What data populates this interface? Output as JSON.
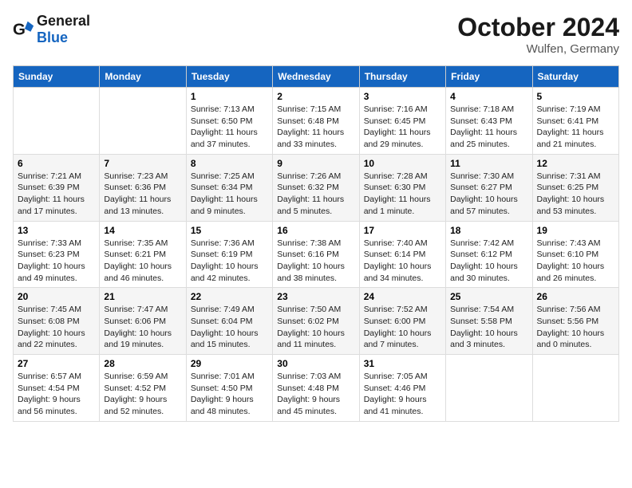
{
  "logo": {
    "general": "General",
    "blue": "Blue"
  },
  "title": "October 2024",
  "location": "Wulfen, Germany",
  "weekdays": [
    "Sunday",
    "Monday",
    "Tuesday",
    "Wednesday",
    "Thursday",
    "Friday",
    "Saturday"
  ],
  "weeks": [
    [
      {
        "day": "",
        "info": ""
      },
      {
        "day": "",
        "info": ""
      },
      {
        "day": "1",
        "info": "Sunrise: 7:13 AM\nSunset: 6:50 PM\nDaylight: 11 hours and 37 minutes."
      },
      {
        "day": "2",
        "info": "Sunrise: 7:15 AM\nSunset: 6:48 PM\nDaylight: 11 hours and 33 minutes."
      },
      {
        "day": "3",
        "info": "Sunrise: 7:16 AM\nSunset: 6:45 PM\nDaylight: 11 hours and 29 minutes."
      },
      {
        "day": "4",
        "info": "Sunrise: 7:18 AM\nSunset: 6:43 PM\nDaylight: 11 hours and 25 minutes."
      },
      {
        "day": "5",
        "info": "Sunrise: 7:19 AM\nSunset: 6:41 PM\nDaylight: 11 hours and 21 minutes."
      }
    ],
    [
      {
        "day": "6",
        "info": "Sunrise: 7:21 AM\nSunset: 6:39 PM\nDaylight: 11 hours and 17 minutes."
      },
      {
        "day": "7",
        "info": "Sunrise: 7:23 AM\nSunset: 6:36 PM\nDaylight: 11 hours and 13 minutes."
      },
      {
        "day": "8",
        "info": "Sunrise: 7:25 AM\nSunset: 6:34 PM\nDaylight: 11 hours and 9 minutes."
      },
      {
        "day": "9",
        "info": "Sunrise: 7:26 AM\nSunset: 6:32 PM\nDaylight: 11 hours and 5 minutes."
      },
      {
        "day": "10",
        "info": "Sunrise: 7:28 AM\nSunset: 6:30 PM\nDaylight: 11 hours and 1 minute."
      },
      {
        "day": "11",
        "info": "Sunrise: 7:30 AM\nSunset: 6:27 PM\nDaylight: 10 hours and 57 minutes."
      },
      {
        "day": "12",
        "info": "Sunrise: 7:31 AM\nSunset: 6:25 PM\nDaylight: 10 hours and 53 minutes."
      }
    ],
    [
      {
        "day": "13",
        "info": "Sunrise: 7:33 AM\nSunset: 6:23 PM\nDaylight: 10 hours and 49 minutes."
      },
      {
        "day": "14",
        "info": "Sunrise: 7:35 AM\nSunset: 6:21 PM\nDaylight: 10 hours and 46 minutes."
      },
      {
        "day": "15",
        "info": "Sunrise: 7:36 AM\nSunset: 6:19 PM\nDaylight: 10 hours and 42 minutes."
      },
      {
        "day": "16",
        "info": "Sunrise: 7:38 AM\nSunset: 6:16 PM\nDaylight: 10 hours and 38 minutes."
      },
      {
        "day": "17",
        "info": "Sunrise: 7:40 AM\nSunset: 6:14 PM\nDaylight: 10 hours and 34 minutes."
      },
      {
        "day": "18",
        "info": "Sunrise: 7:42 AM\nSunset: 6:12 PM\nDaylight: 10 hours and 30 minutes."
      },
      {
        "day": "19",
        "info": "Sunrise: 7:43 AM\nSunset: 6:10 PM\nDaylight: 10 hours and 26 minutes."
      }
    ],
    [
      {
        "day": "20",
        "info": "Sunrise: 7:45 AM\nSunset: 6:08 PM\nDaylight: 10 hours and 22 minutes."
      },
      {
        "day": "21",
        "info": "Sunrise: 7:47 AM\nSunset: 6:06 PM\nDaylight: 10 hours and 19 minutes."
      },
      {
        "day": "22",
        "info": "Sunrise: 7:49 AM\nSunset: 6:04 PM\nDaylight: 10 hours and 15 minutes."
      },
      {
        "day": "23",
        "info": "Sunrise: 7:50 AM\nSunset: 6:02 PM\nDaylight: 10 hours and 11 minutes."
      },
      {
        "day": "24",
        "info": "Sunrise: 7:52 AM\nSunset: 6:00 PM\nDaylight: 10 hours and 7 minutes."
      },
      {
        "day": "25",
        "info": "Sunrise: 7:54 AM\nSunset: 5:58 PM\nDaylight: 10 hours and 3 minutes."
      },
      {
        "day": "26",
        "info": "Sunrise: 7:56 AM\nSunset: 5:56 PM\nDaylight: 10 hours and 0 minutes."
      }
    ],
    [
      {
        "day": "27",
        "info": "Sunrise: 6:57 AM\nSunset: 4:54 PM\nDaylight: 9 hours and 56 minutes."
      },
      {
        "day": "28",
        "info": "Sunrise: 6:59 AM\nSunset: 4:52 PM\nDaylight: 9 hours and 52 minutes."
      },
      {
        "day": "29",
        "info": "Sunrise: 7:01 AM\nSunset: 4:50 PM\nDaylight: 9 hours and 48 minutes."
      },
      {
        "day": "30",
        "info": "Sunrise: 7:03 AM\nSunset: 4:48 PM\nDaylight: 9 hours and 45 minutes."
      },
      {
        "day": "31",
        "info": "Sunrise: 7:05 AM\nSunset: 4:46 PM\nDaylight: 9 hours and 41 minutes."
      },
      {
        "day": "",
        "info": ""
      },
      {
        "day": "",
        "info": ""
      }
    ]
  ]
}
